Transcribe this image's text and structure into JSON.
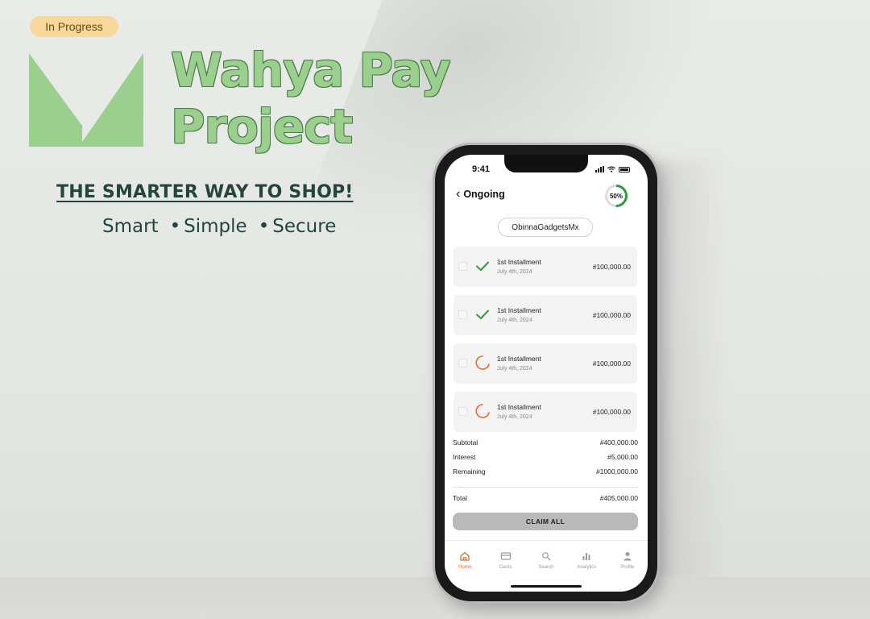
{
  "status_badge": "In Progress",
  "brand": {
    "title_line1": "Wahya Pay",
    "title_line2": "Project"
  },
  "tagline": "THE SMARTER WAY TO SHOP!",
  "pillars": [
    "Smart",
    "Simple",
    "Secure"
  ],
  "phone": {
    "status_time": "9:41",
    "header_title": "Ongoing",
    "progress_label": "50%",
    "progress_value": 0.5,
    "merchant": "ObinnaGadgetsMx",
    "installments": [
      {
        "name": "1st Installment",
        "date": "July 4th, 2024",
        "amount": "#100,000.00",
        "state": "paid"
      },
      {
        "name": "1st Installment",
        "date": "July 4th, 2024",
        "amount": "#100,000.00",
        "state": "paid"
      },
      {
        "name": "1st Installment",
        "date": "July 4th, 2024",
        "amount": "#100,000.00",
        "state": "pending"
      },
      {
        "name": "1st Installment",
        "date": "July 4th, 2024",
        "amount": "#100,000.00",
        "state": "pending"
      }
    ],
    "summary": {
      "subtotal_label": "Subtotal",
      "subtotal": "#400,000.00",
      "interest_label": "Interest",
      "interest": "#5,000.00",
      "remaining_label": "Remaining",
      "remaining": "#1000,000.00",
      "total_label": "Total",
      "total": "#405,000.00"
    },
    "claim_button": "CLAIM ALL",
    "tabs": [
      {
        "label": "Home",
        "icon": "home-icon",
        "active": true
      },
      {
        "label": "Cards",
        "icon": "card-icon",
        "active": false
      },
      {
        "label": "Search",
        "icon": "search-icon",
        "active": false
      },
      {
        "label": "Analytics",
        "icon": "analytics-icon",
        "active": false
      },
      {
        "label": "Profile",
        "icon": "profile-icon",
        "active": false
      }
    ]
  },
  "colors": {
    "brand_green": "#9bcf8e",
    "brand_dark": "#23453a",
    "badge_bg": "#f7d79a",
    "paid_green": "#2e9e3a",
    "pending_orange": "#e86a2c"
  }
}
